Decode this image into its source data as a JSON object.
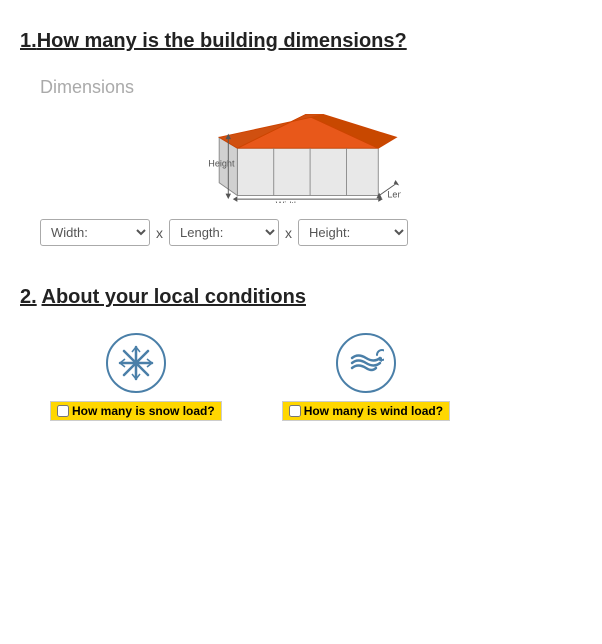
{
  "section1": {
    "title_number": "1.",
    "title_text": "How many is the building  dimensions?",
    "dimensions_label": "Dimensions",
    "diagram_alt": "Building dimensions diagram",
    "label_height": "Height",
    "label_width": "Width",
    "label_length": "Length",
    "dropdowns": {
      "width": {
        "placeholder": "Width:",
        "options": [
          "Width:"
        ]
      },
      "length": {
        "placeholder": "Length:",
        "options": [
          "Length:"
        ]
      },
      "height": {
        "placeholder": "Height:",
        "options": [
          "Height:"
        ]
      }
    },
    "separator": "x"
  },
  "section2": {
    "title_number": "2.",
    "title_text": "About your local conditions",
    "snow_label": "How many is snow load?",
    "wind_label": "How many is wind load?"
  }
}
